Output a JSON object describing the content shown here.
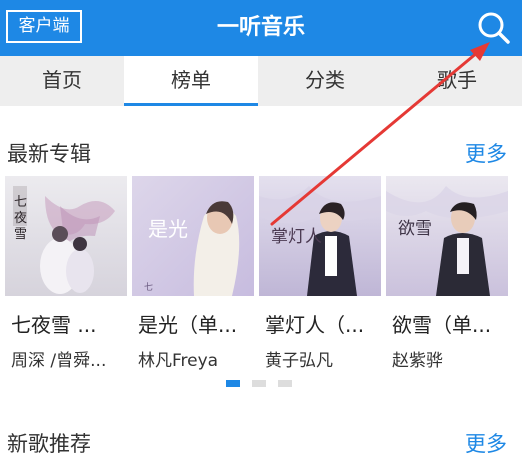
{
  "header": {
    "client_label": "客户端",
    "title": "一听音乐",
    "search_icon": "search-icon"
  },
  "tabs": [
    {
      "label": "首页",
      "active": false
    },
    {
      "label": "榜单",
      "active": true
    },
    {
      "label": "分类",
      "active": false
    },
    {
      "label": "歌手",
      "active": false
    }
  ],
  "latest_albums": {
    "title": "最新专辑",
    "more": "更多",
    "items": [
      {
        "name": "七夜雪 ...",
        "artist": "周深 /曾舜..."
      },
      {
        "name": "是光（单...",
        "artist": "林凡Freya"
      },
      {
        "name": "掌灯人（...",
        "artist": "黄子弘凡"
      },
      {
        "name": "欲雪（单...",
        "artist": "赵紫骅"
      }
    ],
    "pages": 3,
    "current_page": 1
  },
  "new_songs": {
    "title": "新歌推荐",
    "more": "更多"
  },
  "colors": {
    "accent": "#1e88e5",
    "annotation_arrow": "#e53935"
  }
}
